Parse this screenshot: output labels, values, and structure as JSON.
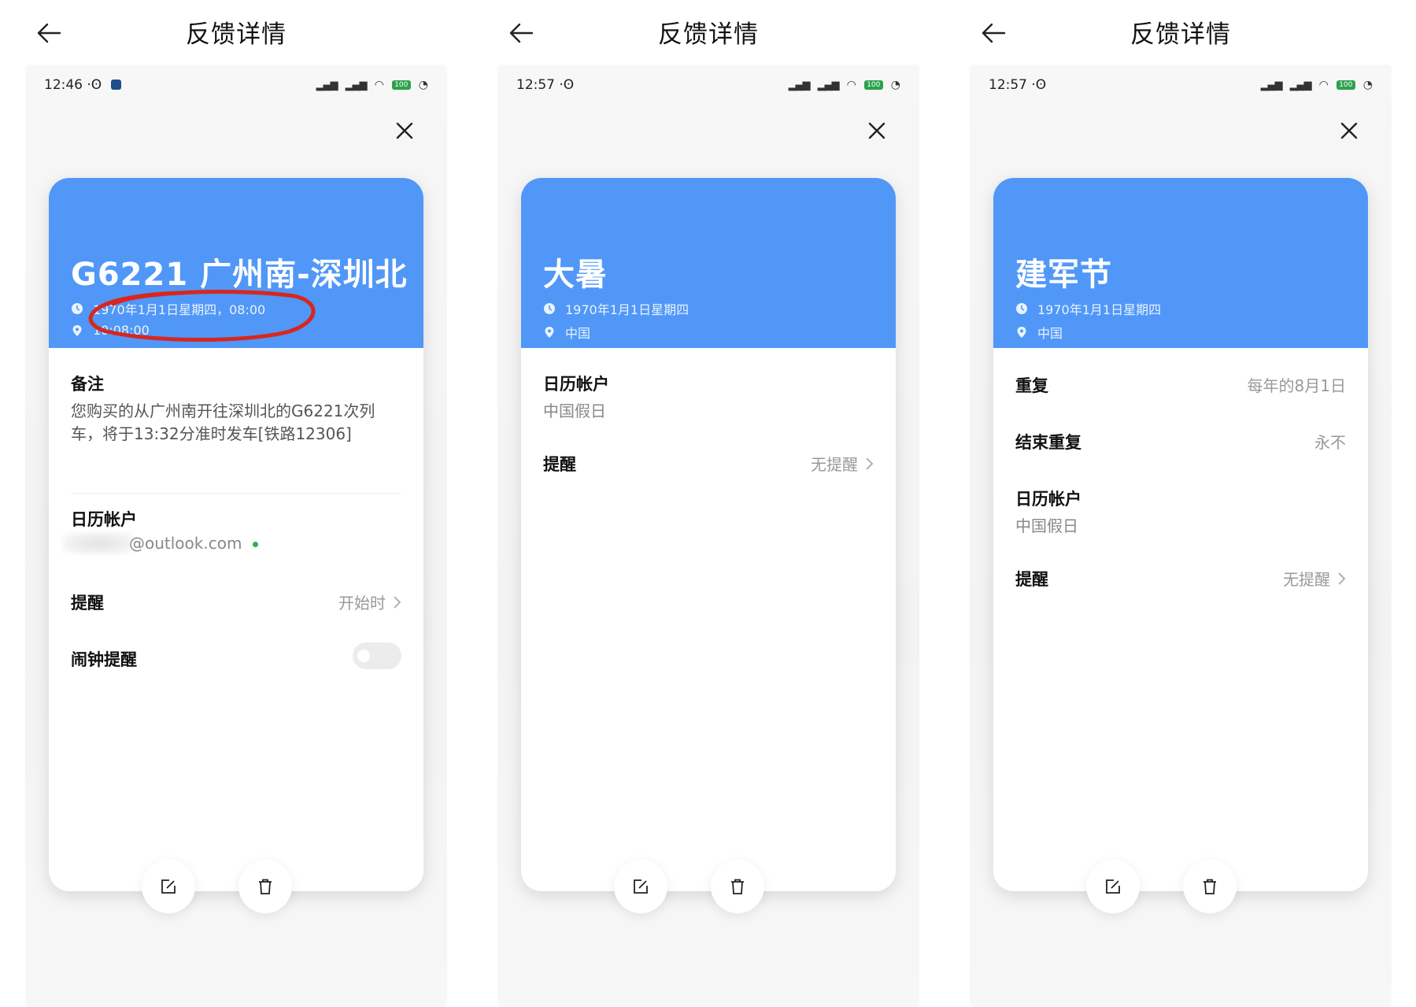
{
  "header_title": "反馈详情",
  "status": {
    "time_1": "12:46",
    "time_2": "12:57",
    "time_3": "12:57",
    "battery": "100"
  },
  "panel1": {
    "title": "G6221 广州南-深圳北",
    "datetime": "1970年1月1日星期四，08:00",
    "location": "10:08:00",
    "note_label": "备注",
    "note_text": "您购买的从广州南开往深圳北的G6221次列车，将于13:32分准时发车[铁路12306]",
    "account_label": "日历帐户",
    "account_value": "@outlook.com",
    "reminder_label": "提醒",
    "reminder_value": "开始时",
    "alarm_label": "闹钟提醒",
    "alarm_on": false
  },
  "panel2": {
    "title": "大暑",
    "date": "1970年1月1日星期四",
    "location": "中国",
    "account_label": "日历帐户",
    "account_value": "中国假日",
    "reminder_label": "提醒",
    "reminder_value": "无提醒"
  },
  "panel3": {
    "title": "建军节",
    "date": "1970年1月1日星期四",
    "location": "中国",
    "repeat_label": "重复",
    "repeat_value": "每年的8月1日",
    "end_repeat_label": "结束重复",
    "end_repeat_value": "永不",
    "account_label": "日历帐户",
    "account_value": "中国假日",
    "reminder_label": "提醒",
    "reminder_value": "无提醒"
  },
  "colors": {
    "card_header": "#5097f8",
    "annotation": "#d9261c",
    "status_green": "#2bb24c"
  },
  "icons": [
    "back-arrow-icon",
    "close-icon",
    "clock-icon",
    "location-pin-icon",
    "chevron-right-icon",
    "edit-icon",
    "trash-icon"
  ]
}
